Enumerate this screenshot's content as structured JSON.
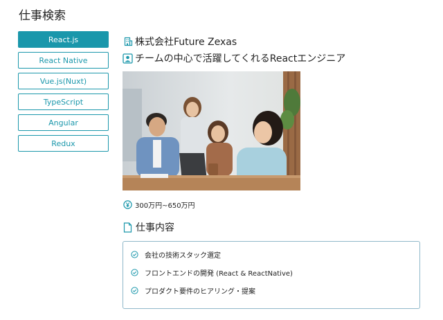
{
  "page": {
    "title": "仕事検索"
  },
  "tabs": [
    {
      "label": "React.js",
      "active": true
    },
    {
      "label": "React Native",
      "active": false
    },
    {
      "label": "Vue.js(Nuxt)",
      "active": false
    },
    {
      "label": "TypeScript",
      "active": false
    },
    {
      "label": "Angular",
      "active": false
    },
    {
      "label": "Redux",
      "active": false
    }
  ],
  "job": {
    "company": "株式会社Future Zexas",
    "title": "チームの中心で活躍してくれるReactエンジニア",
    "salary": "300万円~650万円",
    "section_title": "仕事内容",
    "tasks": [
      "会社の技術スタック選定",
      "フロントエンドの開発 (React & ReactNative)",
      "プロダクト要件のヒアリング・提案"
    ]
  },
  "icons": {
    "company": "building-icon",
    "title": "person-card-icon",
    "salary": "yen-circle-icon",
    "section": "document-icon",
    "task": "check-circle-icon"
  },
  "colors": {
    "accent": "#1a97ab",
    "box_border": "#8fb8c9"
  }
}
